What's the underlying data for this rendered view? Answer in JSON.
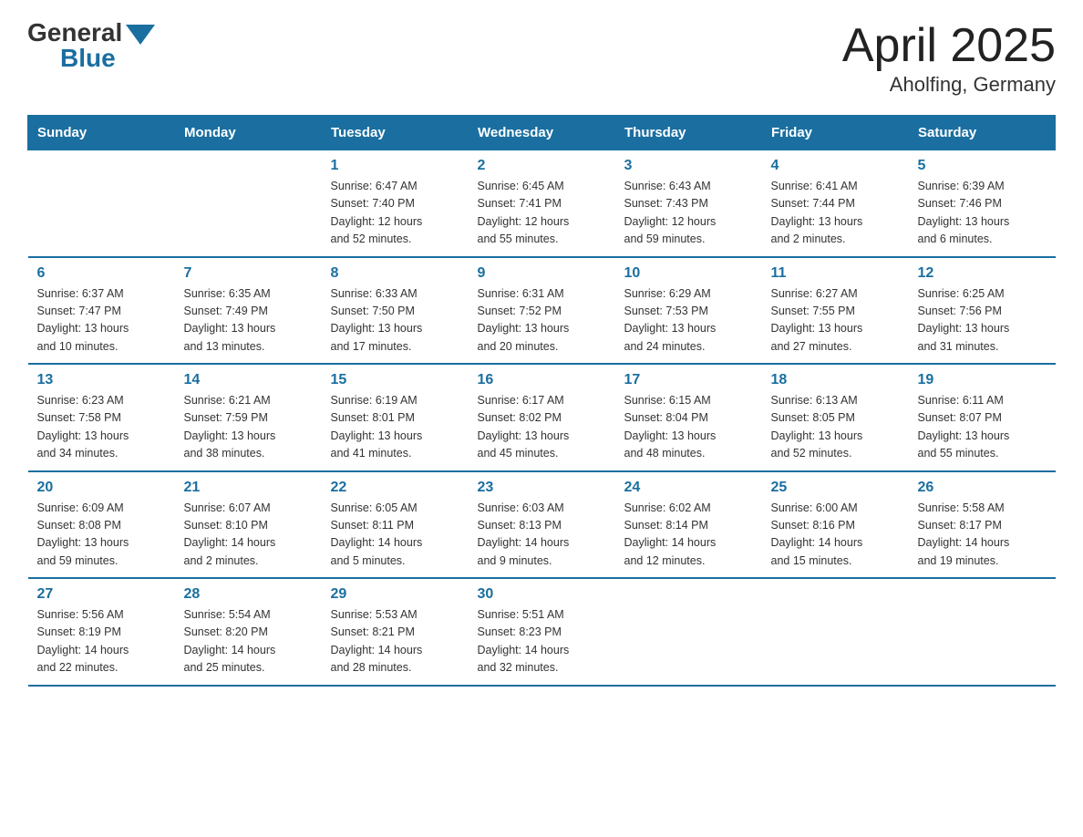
{
  "header": {
    "logo_general": "General",
    "logo_blue": "Blue",
    "month_title": "April 2025",
    "location": "Aholfing, Germany"
  },
  "weekdays": [
    "Sunday",
    "Monday",
    "Tuesday",
    "Wednesday",
    "Thursday",
    "Friday",
    "Saturday"
  ],
  "weeks": [
    [
      {
        "day": "",
        "detail": ""
      },
      {
        "day": "",
        "detail": ""
      },
      {
        "day": "1",
        "detail": "Sunrise: 6:47 AM\nSunset: 7:40 PM\nDaylight: 12 hours\nand 52 minutes."
      },
      {
        "day": "2",
        "detail": "Sunrise: 6:45 AM\nSunset: 7:41 PM\nDaylight: 12 hours\nand 55 minutes."
      },
      {
        "day": "3",
        "detail": "Sunrise: 6:43 AM\nSunset: 7:43 PM\nDaylight: 12 hours\nand 59 minutes."
      },
      {
        "day": "4",
        "detail": "Sunrise: 6:41 AM\nSunset: 7:44 PM\nDaylight: 13 hours\nand 2 minutes."
      },
      {
        "day": "5",
        "detail": "Sunrise: 6:39 AM\nSunset: 7:46 PM\nDaylight: 13 hours\nand 6 minutes."
      }
    ],
    [
      {
        "day": "6",
        "detail": "Sunrise: 6:37 AM\nSunset: 7:47 PM\nDaylight: 13 hours\nand 10 minutes."
      },
      {
        "day": "7",
        "detail": "Sunrise: 6:35 AM\nSunset: 7:49 PM\nDaylight: 13 hours\nand 13 minutes."
      },
      {
        "day": "8",
        "detail": "Sunrise: 6:33 AM\nSunset: 7:50 PM\nDaylight: 13 hours\nand 17 minutes."
      },
      {
        "day": "9",
        "detail": "Sunrise: 6:31 AM\nSunset: 7:52 PM\nDaylight: 13 hours\nand 20 minutes."
      },
      {
        "day": "10",
        "detail": "Sunrise: 6:29 AM\nSunset: 7:53 PM\nDaylight: 13 hours\nand 24 minutes."
      },
      {
        "day": "11",
        "detail": "Sunrise: 6:27 AM\nSunset: 7:55 PM\nDaylight: 13 hours\nand 27 minutes."
      },
      {
        "day": "12",
        "detail": "Sunrise: 6:25 AM\nSunset: 7:56 PM\nDaylight: 13 hours\nand 31 minutes."
      }
    ],
    [
      {
        "day": "13",
        "detail": "Sunrise: 6:23 AM\nSunset: 7:58 PM\nDaylight: 13 hours\nand 34 minutes."
      },
      {
        "day": "14",
        "detail": "Sunrise: 6:21 AM\nSunset: 7:59 PM\nDaylight: 13 hours\nand 38 minutes."
      },
      {
        "day": "15",
        "detail": "Sunrise: 6:19 AM\nSunset: 8:01 PM\nDaylight: 13 hours\nand 41 minutes."
      },
      {
        "day": "16",
        "detail": "Sunrise: 6:17 AM\nSunset: 8:02 PM\nDaylight: 13 hours\nand 45 minutes."
      },
      {
        "day": "17",
        "detail": "Sunrise: 6:15 AM\nSunset: 8:04 PM\nDaylight: 13 hours\nand 48 minutes."
      },
      {
        "day": "18",
        "detail": "Sunrise: 6:13 AM\nSunset: 8:05 PM\nDaylight: 13 hours\nand 52 minutes."
      },
      {
        "day": "19",
        "detail": "Sunrise: 6:11 AM\nSunset: 8:07 PM\nDaylight: 13 hours\nand 55 minutes."
      }
    ],
    [
      {
        "day": "20",
        "detail": "Sunrise: 6:09 AM\nSunset: 8:08 PM\nDaylight: 13 hours\nand 59 minutes."
      },
      {
        "day": "21",
        "detail": "Sunrise: 6:07 AM\nSunset: 8:10 PM\nDaylight: 14 hours\nand 2 minutes."
      },
      {
        "day": "22",
        "detail": "Sunrise: 6:05 AM\nSunset: 8:11 PM\nDaylight: 14 hours\nand 5 minutes."
      },
      {
        "day": "23",
        "detail": "Sunrise: 6:03 AM\nSunset: 8:13 PM\nDaylight: 14 hours\nand 9 minutes."
      },
      {
        "day": "24",
        "detail": "Sunrise: 6:02 AM\nSunset: 8:14 PM\nDaylight: 14 hours\nand 12 minutes."
      },
      {
        "day": "25",
        "detail": "Sunrise: 6:00 AM\nSunset: 8:16 PM\nDaylight: 14 hours\nand 15 minutes."
      },
      {
        "day": "26",
        "detail": "Sunrise: 5:58 AM\nSunset: 8:17 PM\nDaylight: 14 hours\nand 19 minutes."
      }
    ],
    [
      {
        "day": "27",
        "detail": "Sunrise: 5:56 AM\nSunset: 8:19 PM\nDaylight: 14 hours\nand 22 minutes."
      },
      {
        "day": "28",
        "detail": "Sunrise: 5:54 AM\nSunset: 8:20 PM\nDaylight: 14 hours\nand 25 minutes."
      },
      {
        "day": "29",
        "detail": "Sunrise: 5:53 AM\nSunset: 8:21 PM\nDaylight: 14 hours\nand 28 minutes."
      },
      {
        "day": "30",
        "detail": "Sunrise: 5:51 AM\nSunset: 8:23 PM\nDaylight: 14 hours\nand 32 minutes."
      },
      {
        "day": "",
        "detail": ""
      },
      {
        "day": "",
        "detail": ""
      },
      {
        "day": "",
        "detail": ""
      }
    ]
  ]
}
